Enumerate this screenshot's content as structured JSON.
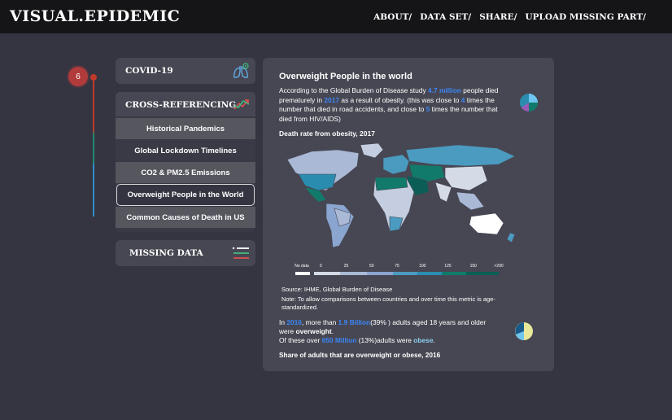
{
  "header": {
    "brand": "VISUAL.EPIDEMIC",
    "nav": [
      "ABOUT/",
      "DATA SET/",
      "SHARE/",
      "UPLOAD MISSING PART/"
    ]
  },
  "timeline": {
    "step": "6"
  },
  "menu": {
    "covid": {
      "title": "COVID-19"
    },
    "cross_ref": {
      "title": "CROSS-REFERENCING",
      "items": [
        "Historical Pandemics",
        "Global Lockdown Timelines",
        "CO2 & PM2.5 Emissions",
        "Overweight People in the World",
        "Common Causes of Death in US"
      ],
      "active_index": 3
    },
    "missing": {
      "title": "MISSING DATA"
    }
  },
  "panel": {
    "title": "Overweight People in the world",
    "para1": {
      "t1": "According to the Global Burden of Disease study ",
      "h1": "4.7 million",
      "t2": " people died prematurely in ",
      "h2": "2017",
      "t3": " as a result of obesity. (this was close to ",
      "h3": "4",
      "t4": " times the number that died in road accidents, and close to ",
      "h4": "5",
      "t5": " times the number that died from HIV/AIDS)"
    },
    "map_title": "Death rate from obesity, 2017",
    "legend": {
      "labels": [
        "No data",
        "0",
        "25",
        "50",
        "75",
        "100",
        "125",
        "150",
        ">200"
      ],
      "colors": [
        "#ffffff",
        "#ffffff",
        "#d4dbe6",
        "#a9b9d6",
        "#8aa5cf",
        "#4b9ac0",
        "#2a8db0",
        "#127a6a",
        "#0b5e56"
      ]
    },
    "source": "Source: IHME, Global Burden of Disease",
    "note": "Note: To allow comparisons between countries and over time this metric is age-standardized.",
    "para2": {
      "t1": "In ",
      "h1": "2016",
      "t2": ", more than ",
      "h2": "1.9 Billion",
      "t3": "(39% ) adults aged 18 years and older were ",
      "h3": "overweight",
      "t4": ".",
      "t5": "Of these over ",
      "h4": "650 Million",
      "t6": " (13%)adults were ",
      "h5": "obese",
      "t7": "."
    },
    "share_title": "Share of adults that are overweight or obese, 2016",
    "colors": {
      "highlight": "#3b86f7",
      "highlight_light": "#8ed0f0",
      "panel": "#474753"
    }
  }
}
